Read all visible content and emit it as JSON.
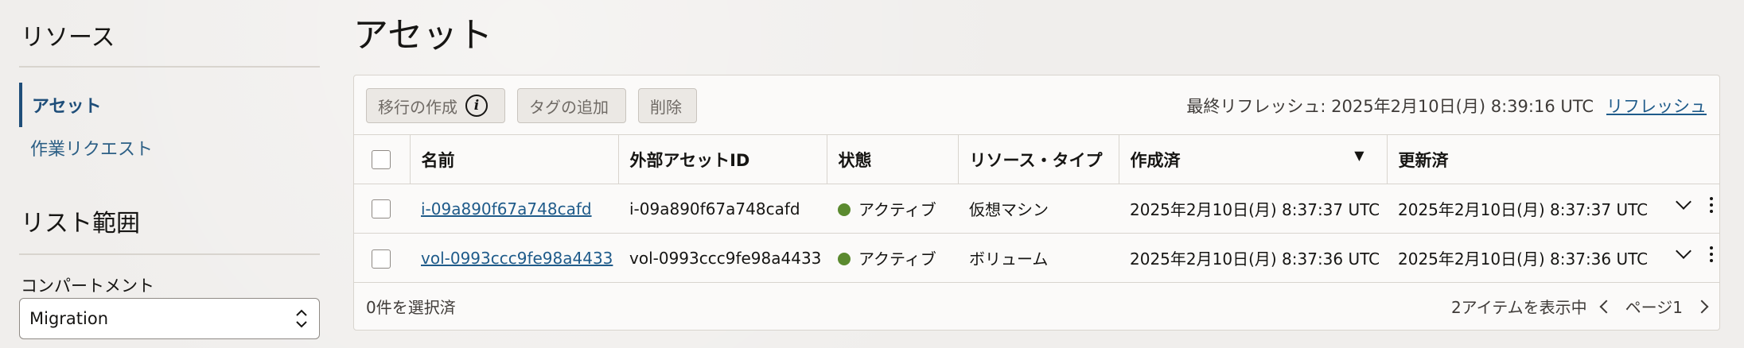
{
  "sidebar": {
    "heading": "リソース",
    "items": [
      {
        "label": "アセット",
        "active": true
      },
      {
        "label": "作業リクエスト",
        "active": false
      }
    ],
    "scope_heading": "リスト範囲",
    "compartment_label": "コンパートメント",
    "compartment_value": "Migration"
  },
  "page": {
    "title": "アセット"
  },
  "toolbar": {
    "create_migration": "移行の作成",
    "add_tag": "タグの追加",
    "delete": "削除",
    "last_refresh": "最終リフレッシュ: 2025年2月10日(月) 8:39:16 UTC",
    "refresh": "リフレッシュ"
  },
  "table": {
    "columns": [
      "名前",
      "外部アセットID",
      "状態",
      "リソース・タイプ",
      "作成済",
      "更新済"
    ],
    "rows": [
      {
        "name": "i-09a890f67a748cafd",
        "external_id": "i-09a890f67a748cafd",
        "state": "アクティブ",
        "type": "仮想マシン",
        "created": "2025年2月10日(月) 8:37:37 UTC",
        "updated": "2025年2月10日(月) 8:37:37 UTC"
      },
      {
        "name": "vol-0993ccc9fe98a4433",
        "external_id": "vol-0993ccc9fe98a4433",
        "state": "アクティブ",
        "type": "ボリューム",
        "created": "2025年2月10日(月) 8:37:36 UTC",
        "updated": "2025年2月10日(月) 8:37:36 UTC"
      }
    ]
  },
  "footer": {
    "selected": "0件を選択済",
    "showing": "2アイテムを表示中",
    "page": "ページ1"
  },
  "colors": {
    "link": "#1f5b8a",
    "active_dot": "#5b8a2f",
    "accent": "#1f4e79"
  }
}
